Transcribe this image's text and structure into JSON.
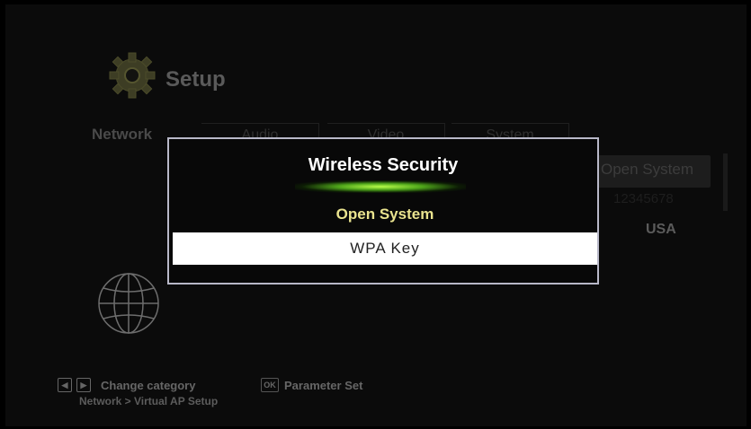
{
  "setup": {
    "title": "Setup",
    "tabs": [
      "Network",
      "Audio",
      "Video",
      "System"
    ]
  },
  "right_panel": {
    "security_value": "Open System",
    "password_value": "12345678",
    "country_value": "USA"
  },
  "footer": {
    "change_category": "Change category",
    "ok_key": "OK",
    "parameter_set": "Parameter Set",
    "breadcrumb": "Network > Virtual AP Setup"
  },
  "dialog": {
    "title": "Wireless Security",
    "options": [
      "Open System",
      "WPA Key"
    ],
    "selected_index": 1
  },
  "colors": {
    "highlight_text": "#e9e38e",
    "selection_bg": "#ffffff",
    "glow": "#9be832"
  },
  "icons": {
    "logo": "gear-icon",
    "section": "globe-icon",
    "left_key": "arrow-left-icon",
    "right_key": "arrow-right-icon"
  }
}
